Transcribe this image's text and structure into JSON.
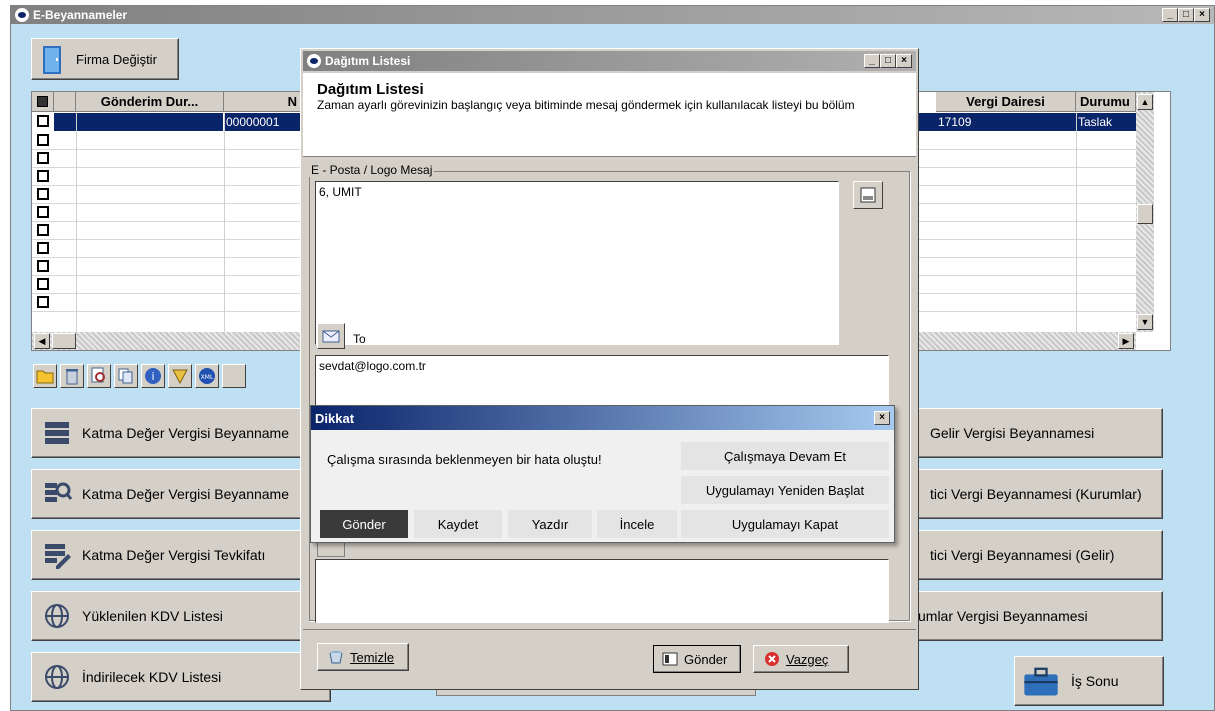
{
  "main_window": {
    "title": "E-Beyannameler",
    "firma_button": "Firma Değiştir",
    "grid": {
      "columns": [
        "Gönderim Dur...",
        "N",
        "Vergi Dairesi",
        "Durumu"
      ],
      "first_row": {
        "no": "00000001",
        "vergi_dairesi": "17109",
        "durumu": "Taslak"
      }
    },
    "buttons_left": [
      "Katma Değer Vergisi Beyanname",
      "Katma Değer Vergisi Beyanname",
      "Katma Değer Vergisi Tevkifatı",
      "Yüklenilen KDV Listesi",
      "İndirilecek KDV Listesi"
    ],
    "buttons_right": [
      "Gelir Vergisi Beyannamesi",
      "tici Vergi Beyannamesi (Kurumlar)",
      "tici Vergi Beyannamesi (Gelir)",
      "umlar Vergisi Beyannamesi"
    ],
    "is_sonu": "İş Sonu"
  },
  "dagitim": {
    "title": "Dağıtım Listesi",
    "header_title": "Dağıtım Listesi",
    "header_desc": "Zaman ayarlı görevinizin başlangıç veya bitiminde mesaj göndermek için kullanılacak listeyi bu bölüm",
    "email_frame_label": "E - Posta / Logo Mesaj",
    "message_text": "6, UMIT",
    "to_label": "To",
    "to_value": "sevdat@logo.com.tr",
    "temizle": "Temizle",
    "gonder": "Gönder",
    "vazgec": "Vazgeç"
  },
  "dikkat": {
    "title": "Dikkat",
    "message": "Çalışma sırasında beklenmeyen bir hata oluştu!",
    "continue": "Çalışmaya Devam Et",
    "restart": "Uygulamayı Yeniden Başlat",
    "close_app": "Uygulamayı Kapat",
    "tabs": [
      "Gönder",
      "Kaydet",
      "Yazdır",
      "İncele"
    ]
  }
}
